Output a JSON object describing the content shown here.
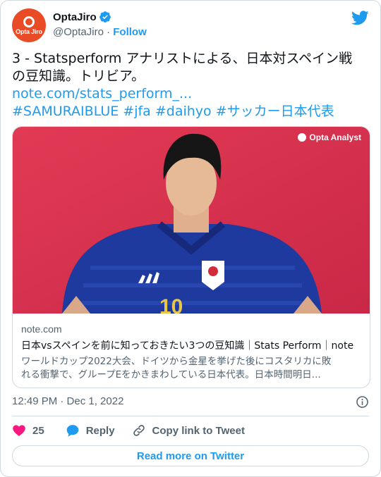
{
  "author": {
    "name": "OptaJiro",
    "handle": "@OptaJiro",
    "separator": "·",
    "follow_label": "Follow",
    "avatar_text": "Opta Jiro",
    "avatar_color": "#ea4b27"
  },
  "tweet": {
    "text_line1": "3 - Statsperform アナリストによる、日本対スペイン戦",
    "text_line2": "の豆知識。トリビア。",
    "link": "note.com/stats_perform_...",
    "hashtags": "#SAMURAIBLUE #jfa #daihyo #サッカー日本代表"
  },
  "card": {
    "image_brand": "Opta Analyst",
    "domain": "note.com",
    "title": "日本vsスペインを前に知っておきたい3つの豆知識｜Stats Perform｜note",
    "desc_line1": "ワールドカップ2022大会、ドイツから金星を挙げた後にコスタリカに敗",
    "desc_line2": "れる衝撃で、グループEをかきまわしている日本代表。日本時間明日..."
  },
  "meta": {
    "timestamp": "12:49 PM · Dec 1, 2022"
  },
  "actions": {
    "like_count": "25",
    "reply_label": "Reply",
    "copy_label": "Copy link to Tweet"
  },
  "footer": {
    "read_more": "Read more on Twitter"
  },
  "colors": {
    "accent": "#1d9bf0",
    "like": "#f91880",
    "card_background": "#e03553",
    "jersey": "#1e3a9e"
  },
  "icons": [
    "verified-badge-icon",
    "twitter-bird-icon",
    "info-icon",
    "heart-icon",
    "reply-bubble-icon",
    "link-icon"
  ]
}
